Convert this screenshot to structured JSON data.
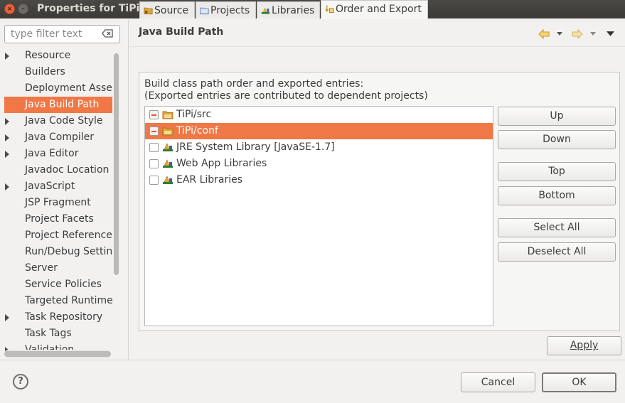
{
  "window": {
    "title": "Properties for TiPi",
    "close_symbol": "×",
    "min_symbol": "–"
  },
  "filter": {
    "placeholder": "type filter text"
  },
  "tree": {
    "items": [
      {
        "label": "Resource",
        "expandable": true,
        "selected": false
      },
      {
        "label": "Builders",
        "expandable": false,
        "selected": false
      },
      {
        "label": "Deployment Assembly",
        "expandable": false,
        "selected": false
      },
      {
        "label": "Java Build Path",
        "expandable": false,
        "selected": true
      },
      {
        "label": "Java Code Style",
        "expandable": true,
        "selected": false
      },
      {
        "label": "Java Compiler",
        "expandable": true,
        "selected": false
      },
      {
        "label": "Java Editor",
        "expandable": true,
        "selected": false
      },
      {
        "label": "Javadoc Location",
        "expandable": false,
        "selected": false
      },
      {
        "label": "JavaScript",
        "expandable": true,
        "selected": false
      },
      {
        "label": "JSP Fragment",
        "expandable": false,
        "selected": false
      },
      {
        "label": "Project Facets",
        "expandable": false,
        "selected": false
      },
      {
        "label": "Project References",
        "expandable": false,
        "selected": false
      },
      {
        "label": "Run/Debug Settings",
        "expandable": false,
        "selected": false
      },
      {
        "label": "Server",
        "expandable": false,
        "selected": false
      },
      {
        "label": "Service Policies",
        "expandable": false,
        "selected": false
      },
      {
        "label": "Targeted Runtimes",
        "expandable": false,
        "selected": false
      },
      {
        "label": "Task Repository",
        "expandable": true,
        "selected": false
      },
      {
        "label": "Task Tags",
        "expandable": false,
        "selected": false
      },
      {
        "label": "Validation",
        "expandable": true,
        "selected": false
      }
    ]
  },
  "page": {
    "title": "Java Build Path"
  },
  "tabs": [
    {
      "label": "Source",
      "icon": "source-folder-icon",
      "active": false
    },
    {
      "label": "Projects",
      "icon": "project-folder-icon",
      "active": false
    },
    {
      "label": "Libraries",
      "icon": "library-icon",
      "active": false
    },
    {
      "label": "Order and Export",
      "icon": "order-export-icon",
      "active": true
    }
  ],
  "order_export": {
    "description_line1": "Build class path order and exported entries:",
    "description_line2": "(Exported entries are contributed to dependent projects)",
    "entries": [
      {
        "label": "TiPi/src",
        "icon": "source-folder-icon",
        "check": "partial",
        "selected": false
      },
      {
        "label": "TiPi/conf",
        "icon": "source-folder-icon",
        "check": "partial",
        "selected": true
      },
      {
        "label": "JRE System Library [JavaSE-1.7]",
        "icon": "library-icon",
        "check": "unchecked",
        "selected": false
      },
      {
        "label": "Web App Libraries",
        "icon": "library-icon",
        "check": "unchecked",
        "selected": false
      },
      {
        "label": "EAR Libraries",
        "icon": "library-icon",
        "check": "unchecked",
        "selected": false
      }
    ],
    "buttons": {
      "up": "Up",
      "down": "Down",
      "top": "Top",
      "bottom": "Bottom",
      "select_all": "Select All",
      "deselect_all": "Deselect All"
    }
  },
  "buttons": {
    "apply": "Apply",
    "cancel": "Cancel",
    "ok": "OK"
  },
  "help": {
    "symbol": "?"
  },
  "colors": {
    "selection": "#f07746",
    "titlebar": "#3b3a36",
    "folder": "#e3a63b",
    "library": "#2f7d32",
    "partial_mark": "#e05a2b"
  }
}
